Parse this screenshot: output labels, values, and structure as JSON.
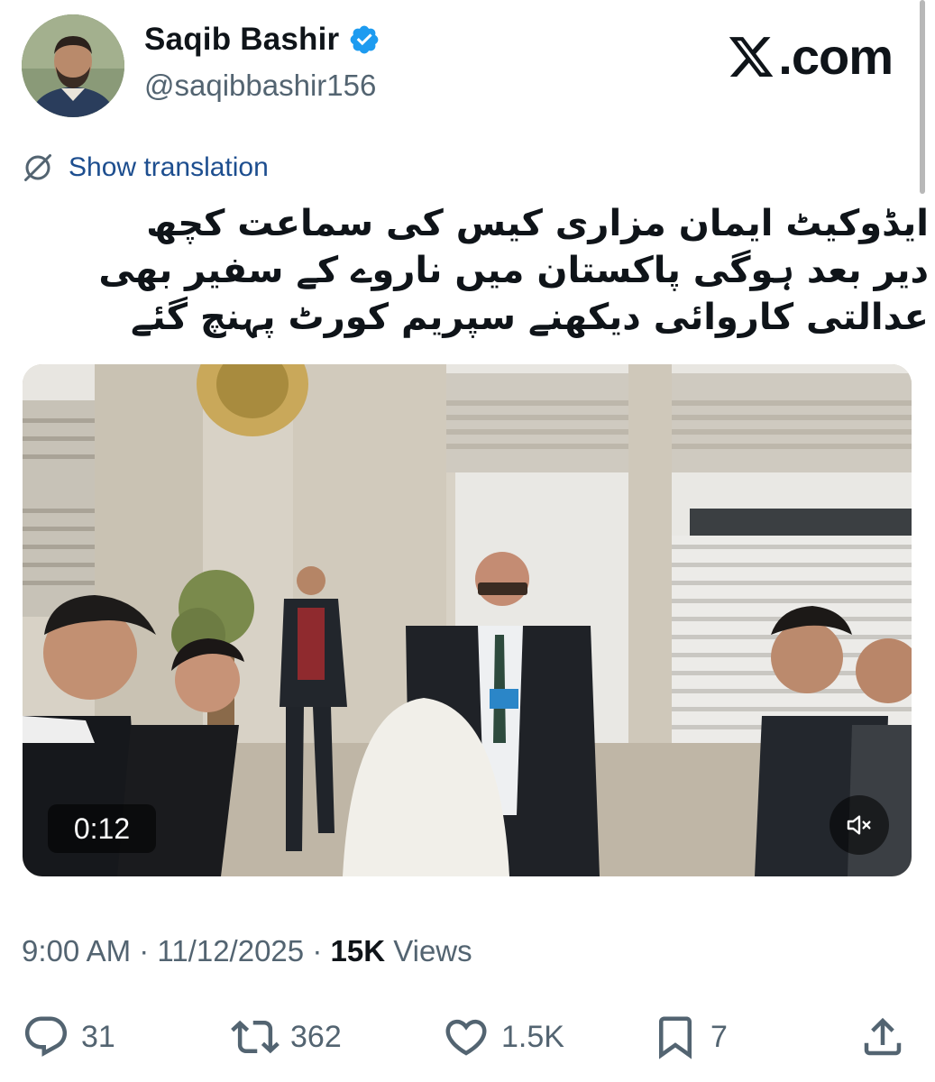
{
  "author": {
    "display_name": "Saqib Bashir",
    "handle": "@saqibbashir156",
    "verified": true
  },
  "brand": {
    "domain_suffix": ".com",
    "icon": "x-logo-icon"
  },
  "translate": {
    "label": "Show translation",
    "icon": "globe-slash-icon"
  },
  "tweet": {
    "text": "ایڈوکیٹ ایمان مزاری کیس کی سماعت کچھ دیر بعد ہوگی پاکستان میں ناروے کے سفیر بھی عدالتی کاروائی دیکھنے سپریم کورٹ پہنچ گئے"
  },
  "media": {
    "duration": "0:12",
    "mute_icon": "speaker-muted-icon"
  },
  "meta": {
    "time": "9:00 AM",
    "separator": "·",
    "date": "11/12/2025",
    "views_count": "15K",
    "views_label": "Views"
  },
  "actions": {
    "replies": "31",
    "reposts": "362",
    "likes": "1.5K",
    "bookmarks": "7"
  },
  "colors": {
    "verified_badge": "#1d9bf0",
    "link_blue": "#1d4e8f",
    "secondary_text": "#536471",
    "primary_text": "#0f1419"
  }
}
